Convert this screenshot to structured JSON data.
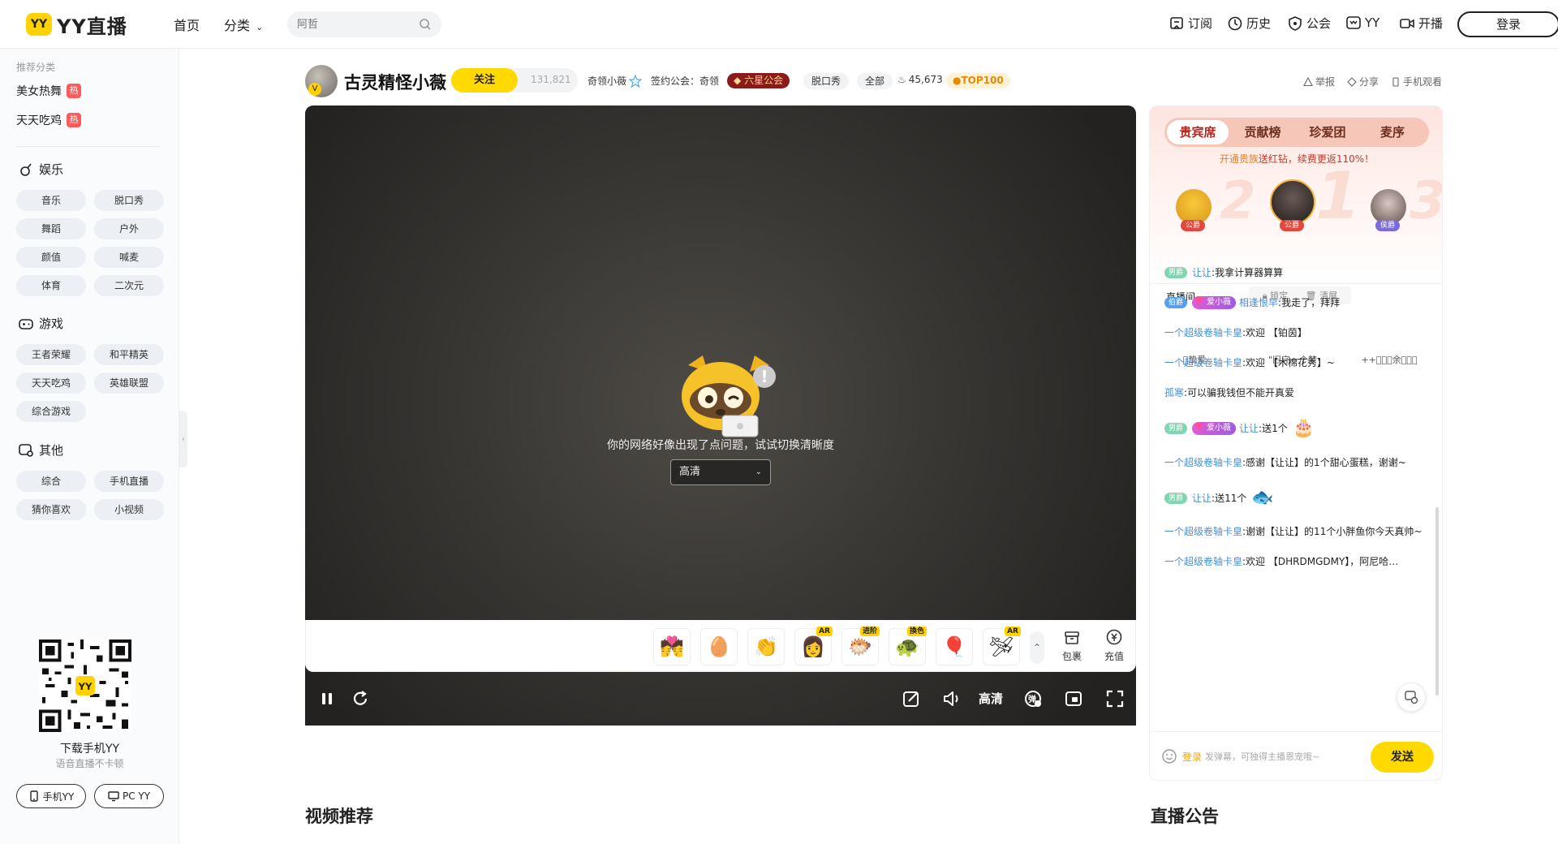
{
  "header": {
    "logo_badge": "YY",
    "logo_text": "YY直播",
    "nav": {
      "home": "首页",
      "category": "分类"
    },
    "search": {
      "placeholder": "阿哲"
    },
    "items": {
      "subscribe": "订阅",
      "history": "历史",
      "guild": "公会",
      "yy": "YY",
      "broadcast": "开播"
    },
    "login": "登录"
  },
  "sidebar": {
    "caption": "推荐分类",
    "hot": [
      {
        "label": "美女热舞",
        "badge": "热"
      },
      {
        "label": "天天吃鸡",
        "badge": "热"
      }
    ],
    "sections": [
      {
        "title": "娱乐",
        "icon": "mic-icon",
        "items": [
          "音乐",
          "脱口秀",
          "舞蹈",
          "户外",
          "颜值",
          "喊麦",
          "体育",
          "二次元"
        ]
      },
      {
        "title": "游戏",
        "icon": "gamepad-icon",
        "items": [
          "王者荣耀",
          "和平精英",
          "天天吃鸡",
          "英雄联盟",
          "综合游戏"
        ]
      },
      {
        "title": "其他",
        "icon": "other-icon",
        "items": [
          "综合",
          "手机直播",
          "猜你喜欢",
          "小视频"
        ]
      }
    ],
    "qr_title": "下载手机YY",
    "qr_sub": "语音直播不卡顿",
    "mobile_btn": "手机YY",
    "pc_btn": "PC YY"
  },
  "streamer": {
    "name": "古灵精怪小薇",
    "follow": "关注",
    "followers": "131,821",
    "short_name": "奇领小薇",
    "contract": "签约公会：奇领",
    "guild_badge": "六星公会",
    "tag1": "脱口秀",
    "tag2": "全部",
    "heat": "45,673",
    "top": "TOP100",
    "report": "举报",
    "share": "分享",
    "mobile_watch": "手机观看"
  },
  "player": {
    "error_message": "你的网络好像出现了点问题，试试切换清晰度",
    "quality_selected": "高清",
    "quality_label": "高清"
  },
  "gifts": {
    "items": [
      {
        "icon": "kiss-gift-icon",
        "glyph": "💏",
        "tag": ""
      },
      {
        "icon": "egg-gift-icon",
        "glyph": "🥚",
        "tag": ""
      },
      {
        "icon": "clap-gift-icon",
        "glyph": "👏",
        "tag": ""
      },
      {
        "icon": "girl-gift-icon",
        "glyph": "👩",
        "tag": "AR"
      },
      {
        "icon": "fish-gift-icon",
        "glyph": "🐡",
        "tag": "进阶"
      },
      {
        "icon": "turtle-gift-icon",
        "glyph": "🐢",
        "tag": "換色"
      },
      {
        "icon": "balloon-gift-icon",
        "glyph": "🎈",
        "tag": ""
      },
      {
        "icon": "plane-gift-icon",
        "glyph": "🛩",
        "tag": "AR"
      }
    ],
    "bag": "包裹",
    "recharge": "充值"
  },
  "rank": {
    "tabs": [
      "贵宾席",
      "贡献榜",
      "珍爱团",
      "麦序"
    ],
    "vip_link": "开通贵族",
    "vip_note": "送红钻，续费更返110%！",
    "podium": [
      {
        "rank": "2",
        "label": "公爵",
        "name": "\u0000挚爱"
      },
      {
        "rank": "1",
        "label": "公爵",
        "name": "\"旧守一个梦"
      },
      {
        "rank": "3",
        "label": "侯爵",
        "name": "++\u0000\u0000\u0000余\u0000\u0000\u0000"
      }
    ]
  },
  "chat": {
    "room_label": "直播间",
    "lock": "锁定",
    "clear": "清屏",
    "messages": [
      {
        "badge": "男爵",
        "fan": "",
        "user": "让让",
        "text": ":我拿计算器算算",
        "gift": ""
      },
      {
        "badge": "伯爵",
        "fan": "爱小薇",
        "user": "相逢恨早",
        "text": ":我走了，拜拜",
        "gift": ""
      },
      {
        "badge": "",
        "fan": "",
        "user": "一个超级卷轴卡皇",
        "text": ":欢迎 【铂茵】",
        "gift": ""
      },
      {
        "badge": "",
        "fan": "",
        "user": "一个超级卷轴卡皇",
        "text": ":欢迎 【木棉花秀】~",
        "gift": ""
      },
      {
        "badge": "",
        "fan": "",
        "user": "孤寒",
        "text": ":可以骗我钱但不能开真爱",
        "gift": ""
      },
      {
        "badge": "男爵",
        "fan": "爱小薇",
        "user": "让让",
        "text": ":送1个",
        "gift": "🎂"
      },
      {
        "badge": "",
        "fan": "",
        "user": "一个超级卷轴卡皇",
        "text": ":感谢【让让】的1个甜心蛋糕，谢谢~",
        "gift": ""
      },
      {
        "badge": "男爵",
        "fan": "",
        "user": "让让",
        "text": ":送11个",
        "gift": "🐟"
      },
      {
        "badge": "",
        "fan": "",
        "user": "一个超级卷轴卡皇",
        "text": ":谢谢【让让】的11个小胖鱼你今天真帅~",
        "gift": ""
      },
      {
        "badge": "",
        "fan": "",
        "user": "一个超级卷轴卡皇",
        "text": ":欢迎 【DHRDMGDMY】，阿尼哈…",
        "gift": ""
      }
    ],
    "login": "登录",
    "placeholder": "发弹幕，可独得主播恩宠哦~",
    "send": "发送"
  },
  "sections": {
    "video_recommend": "视频推荐",
    "announcement": "直播公告"
  },
  "colors": {
    "brand": "#ffd900",
    "link": "#4a8fd9",
    "baron": "#7fd6b0",
    "count": "#5aa0e8"
  }
}
